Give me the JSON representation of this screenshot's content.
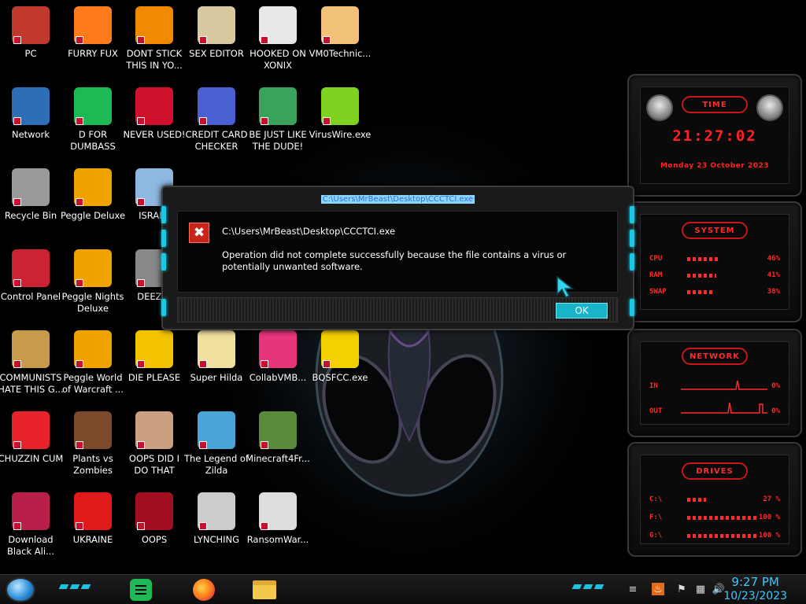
{
  "desktop": {
    "icons": [
      {
        "label": "PC",
        "col": 0,
        "row": 0
      },
      {
        "label": "FURRY FUX",
        "col": 1,
        "row": 0
      },
      {
        "label": "DONT STICK THIS IN YO...",
        "col": 2,
        "row": 0
      },
      {
        "label": "SEX EDITOR",
        "col": 3,
        "row": 0
      },
      {
        "label": "HOOKED ON XONIX",
        "col": 4,
        "row": 0
      },
      {
        "label": "VM0Technic...",
        "col": 5,
        "row": 0
      },
      {
        "label": "Network",
        "col": 0,
        "row": 1
      },
      {
        "label": "D FOR DUMBASS",
        "col": 1,
        "row": 1
      },
      {
        "label": "NEVER USED!",
        "col": 2,
        "row": 1
      },
      {
        "label": "CREDIT CARD CHECKER",
        "col": 3,
        "row": 1
      },
      {
        "label": "BE JUST LIKE THE DUDE!",
        "col": 4,
        "row": 1
      },
      {
        "label": "VirusWire.exe",
        "col": 5,
        "row": 1
      },
      {
        "label": "Recycle Bin",
        "col": 0,
        "row": 2
      },
      {
        "label": "Peggle Deluxe",
        "col": 1,
        "row": 2
      },
      {
        "label": "ISRAEL",
        "col": 2,
        "row": 2
      },
      {
        "label": "Control Panel",
        "col": 0,
        "row": 3
      },
      {
        "label": "Peggle Nights Deluxe",
        "col": 1,
        "row": 3
      },
      {
        "label": "DEEZ N",
        "col": 2,
        "row": 3
      },
      {
        "label": "COMMUNISTS HATE THIS G...",
        "col": 0,
        "row": 4
      },
      {
        "label": "Peggle World of Warcraft ...",
        "col": 1,
        "row": 4
      },
      {
        "label": "DIE PLEASE",
        "col": 2,
        "row": 4
      },
      {
        "label": "Super Hilda",
        "col": 3,
        "row": 4
      },
      {
        "label": "CollabVMB...",
        "col": 4,
        "row": 4
      },
      {
        "label": "BQSFCC.exe",
        "col": 5,
        "row": 4
      },
      {
        "label": "CHUZZIN CUM",
        "col": 0,
        "row": 5
      },
      {
        "label": "Plants vs Zombies",
        "col": 1,
        "row": 5
      },
      {
        "label": "OOPS DID I DO THAT",
        "col": 2,
        "row": 5
      },
      {
        "label": "The Legend of Zilda",
        "col": 3,
        "row": 5
      },
      {
        "label": "Minecraft4Fr...",
        "col": 4,
        "row": 5
      },
      {
        "label": "Download Black Ali...",
        "col": 0,
        "row": 6
      },
      {
        "label": "UKRAINE",
        "col": 1,
        "row": 6
      },
      {
        "label": "OOPS",
        "col": 2,
        "row": 6
      },
      {
        "label": "LYNCHING",
        "col": 3,
        "row": 6
      },
      {
        "label": "RansomWar...",
        "col": 4,
        "row": 6
      }
    ],
    "icon_colors": [
      "#c0392b",
      "#ff7b1c",
      "#f08a00",
      "#d9c9a0",
      "#e8e8e8",
      "#f2c27a",
      "#2c6fb7",
      "#1db954",
      "#d0112b",
      "#4a5fd1",
      "#3aa35a",
      "#7ed321",
      "#999999",
      "#f0a200",
      "#8fb8e0",
      "#cc2233",
      "#f0a200",
      "#888888",
      "#c89b4a",
      "#f0a200",
      "#f3c200",
      "#f0e0a0",
      "#e8357a",
      "#f3d000",
      "#e8232b",
      "#7a4a2a",
      "#caa080",
      "#4aa4d8",
      "#5a8a3a",
      "#b8204a",
      "#e01a1a",
      "#a01020",
      "#cccccc",
      "#dddddd"
    ]
  },
  "widgets": {
    "time": {
      "title": "Time",
      "clock": "21:27:02",
      "date": "Monday 23 October 2023"
    },
    "system": {
      "title": "System",
      "rows": [
        {
          "name": "CPU",
          "value": "46%",
          "fraction": 0.46
        },
        {
          "name": "RAM",
          "value": "41%",
          "fraction": 0.41
        },
        {
          "name": "SWAP",
          "value": "38%",
          "fraction": 0.38
        }
      ]
    },
    "network": {
      "title": "Network",
      "rows": [
        {
          "name": "IN",
          "value": "0%"
        },
        {
          "name": "OUT",
          "value": "0%"
        }
      ]
    },
    "drives": {
      "title": "Drives",
      "rows": [
        {
          "name": "C:\\",
          "value": "27 %",
          "fraction": 0.27
        },
        {
          "name": "F:\\",
          "value": "100 %",
          "fraction": 1.0
        },
        {
          "name": "G:\\",
          "value": "100 %",
          "fraction": 1.0
        }
      ]
    }
  },
  "dialog": {
    "title": "C:\\Users\\MrBeast\\Desktop\\CCCTCI.exe",
    "path": "C:\\Users\\MrBeast\\Desktop\\CCCTCI.exe",
    "message": "Operation did not complete successfully because the file contains a virus or potentially unwanted software.",
    "ok_label": "OK"
  },
  "taskbar": {
    "clock_time": "9:27 PM",
    "clock_date": "10/23/2023",
    "accent": "#1ac3e0"
  }
}
